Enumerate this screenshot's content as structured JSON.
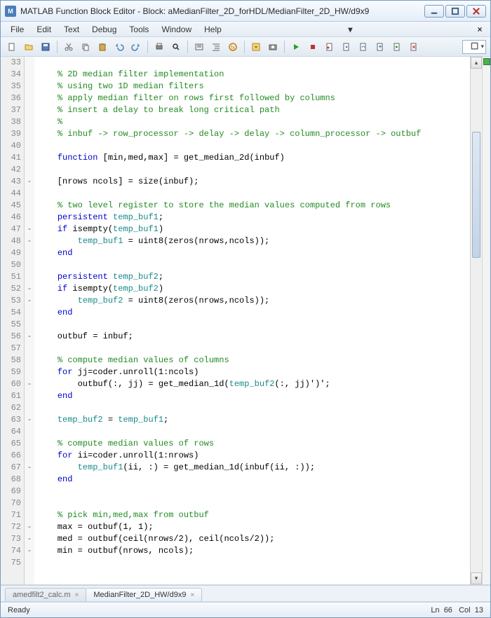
{
  "titlebar": {
    "app_icon_text": "M",
    "title": "MATLAB Function Block Editor - Block: aMedianFilter_2D_forHDL/MedianFilter_2D_HW/d9x9"
  },
  "menubar": {
    "items": [
      "File",
      "Edit",
      "Text",
      "Debug",
      "Tools",
      "Window",
      "Help"
    ]
  },
  "code": {
    "lines": [
      {
        "num": "33",
        "fold": " ",
        "html": ""
      },
      {
        "num": "34",
        "fold": " ",
        "html": "    <span class='cm'>% 2D median filter implementation</span>"
      },
      {
        "num": "35",
        "fold": " ",
        "html": "    <span class='cm'>% using two 1D median filters</span>"
      },
      {
        "num": "36",
        "fold": " ",
        "html": "    <span class='cm'>% apply median filter on rows first followed by columns</span>"
      },
      {
        "num": "37",
        "fold": " ",
        "html": "    <span class='cm'>% insert a delay to break long critical path</span>"
      },
      {
        "num": "38",
        "fold": " ",
        "html": "    <span class='cm'>%</span>"
      },
      {
        "num": "39",
        "fold": " ",
        "html": "    <span class='cm'>% inbuf -> row_processor -> delay -> delay -> column_processor -> outbuf</span>"
      },
      {
        "num": "40",
        "fold": " ",
        "html": ""
      },
      {
        "num": "41",
        "fold": " ",
        "html": "    <span class='kw'>function</span> [min,med,max] = <span class='fn'>get_median_2d</span>(inbuf)"
      },
      {
        "num": "42",
        "fold": " ",
        "html": ""
      },
      {
        "num": "43",
        "fold": "-",
        "html": "    [nrows ncols] = size(inbuf);"
      },
      {
        "num": "44",
        "fold": " ",
        "html": ""
      },
      {
        "num": "45",
        "fold": " ",
        "html": "    <span class='cm'>% two level register to store the median values computed from rows</span>"
      },
      {
        "num": "46",
        "fold": " ",
        "html": "    <span class='kw'>persistent</span> <span class='id'>temp_buf1</span>;"
      },
      {
        "num": "47",
        "fold": "-",
        "html": "    <span class='kw'>if</span> isempty(<span class='id'>temp_buf1</span>)"
      },
      {
        "num": "48",
        "fold": "-",
        "html": "        <span class='id'>temp_buf1</span> = uint8(zeros(nrows,ncols));"
      },
      {
        "num": "49",
        "fold": " ",
        "html": "    <span class='kw'>end</span>"
      },
      {
        "num": "50",
        "fold": " ",
        "html": ""
      },
      {
        "num": "51",
        "fold": " ",
        "html": "    <span class='kw'>persistent</span> <span class='id'>temp_buf2</span>;"
      },
      {
        "num": "52",
        "fold": "-",
        "html": "    <span class='kw'>if</span> isempty(<span class='id'>temp_buf2</span>)"
      },
      {
        "num": "53",
        "fold": "-",
        "html": "        <span class='id'>temp_buf2</span> = uint8(zeros(nrows,ncols));"
      },
      {
        "num": "54",
        "fold": " ",
        "html": "    <span class='kw'>end</span>"
      },
      {
        "num": "55",
        "fold": " ",
        "html": ""
      },
      {
        "num": "56",
        "fold": "-",
        "html": "    outbuf = inbuf;"
      },
      {
        "num": "57",
        "fold": " ",
        "html": ""
      },
      {
        "num": "58",
        "fold": " ",
        "html": "    <span class='cm'>% compute median values of columns</span>"
      },
      {
        "num": "59",
        "fold": " ",
        "html": "    <span class='kw'>for</span> jj=coder.unroll(1:ncols)"
      },
      {
        "num": "60",
        "fold": "-",
        "html": "        outbuf(:, jj) = get_median_1d(<span class='id'>temp_buf2</span>(:, jj)')';"
      },
      {
        "num": "61",
        "fold": " ",
        "html": "    <span class='kw'>end</span>"
      },
      {
        "num": "62",
        "fold": " ",
        "html": ""
      },
      {
        "num": "63",
        "fold": "-",
        "html": "    <span class='id'>temp_buf2</span> = <span class='id'>temp_buf1</span>;"
      },
      {
        "num": "64",
        "fold": " ",
        "html": ""
      },
      {
        "num": "65",
        "fold": " ",
        "html": "    <span class='cm'>% compute median values of rows</span>"
      },
      {
        "num": "66",
        "fold": " ",
        "html": "    <span class='kw'>for</span> ii=coder.unroll(1:nrows)"
      },
      {
        "num": "67",
        "fold": "-",
        "html": "        <span class='id'>temp_buf1</span>(ii, :) = get_median_1d(inbuf(ii, :));"
      },
      {
        "num": "68",
        "fold": " ",
        "html": "    <span class='kw'>end</span>"
      },
      {
        "num": "69",
        "fold": " ",
        "html": ""
      },
      {
        "num": "70",
        "fold": " ",
        "html": ""
      },
      {
        "num": "71",
        "fold": " ",
        "html": "    <span class='cm'>% pick min,med,max from outbuf</span>"
      },
      {
        "num": "72",
        "fold": "-",
        "html": "    max = outbuf(1, 1);"
      },
      {
        "num": "73",
        "fold": "-",
        "html": "    med = outbuf(ceil(nrows/2), ceil(ncols/2));"
      },
      {
        "num": "74",
        "fold": "-",
        "html": "    min = outbuf(nrows, ncols);"
      },
      {
        "num": "75",
        "fold": " ",
        "html": ""
      }
    ]
  },
  "tabs": [
    {
      "label": "amedfilt2_calc.m",
      "active": false
    },
    {
      "label": "MedianFilter_2D_HW/d9x9",
      "active": true
    }
  ],
  "status": {
    "ready": "Ready",
    "ln_label": "Ln",
    "ln_val": "66",
    "col_label": "Col",
    "col_val": "13"
  }
}
